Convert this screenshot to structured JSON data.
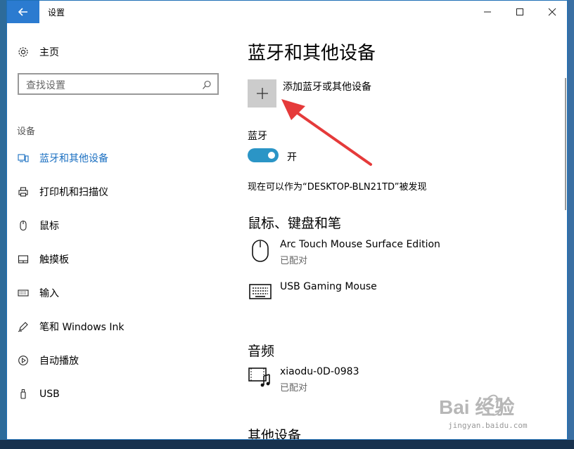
{
  "window": {
    "title": "设置"
  },
  "sidebar": {
    "home": "主页",
    "search_placeholder": "查找设置",
    "section": "设备",
    "items": [
      {
        "label": "蓝牙和其他设备",
        "icon": "bluetooth-devices-icon",
        "active": true
      },
      {
        "label": "打印机和扫描仪",
        "icon": "printer-icon"
      },
      {
        "label": "鼠标",
        "icon": "mouse-icon"
      },
      {
        "label": "触摸板",
        "icon": "touchpad-icon"
      },
      {
        "label": "输入",
        "icon": "keyboard-icon"
      },
      {
        "label": "笔和 Windows Ink",
        "icon": "pen-icon"
      },
      {
        "label": "自动播放",
        "icon": "autoplay-icon"
      },
      {
        "label": "USB",
        "icon": "usb-icon"
      }
    ]
  },
  "main": {
    "title": "蓝牙和其他设备",
    "add_label": "添加蓝牙或其他设备",
    "bluetooth_heading": "蓝牙",
    "bluetooth_state": "开",
    "discoverable": "现在可以作为“DESKTOP-BLN21TD”被发现",
    "mouse_section": "鼠标、键盘和笔",
    "mouse_devices": [
      {
        "name": "Arc Touch Mouse Surface Edition",
        "status": "已配对",
        "icon": "mouse-icon"
      },
      {
        "name": "USB Gaming Mouse",
        "status": "",
        "icon": "keyboard-icon"
      }
    ],
    "audio_section": "音频",
    "audio_devices": [
      {
        "name": "xiaodu-0D-0983",
        "status": "已配对",
        "icon": "audio-device-icon"
      }
    ],
    "other_section": "其他设备"
  },
  "watermark": {
    "brand": "Bai 经验",
    "url": "jingyan.baidu.com"
  },
  "colors": {
    "accent": "#1a6fc1",
    "back_button": "#2b7bd0",
    "toggle_on": "#2b95c6",
    "arrow": "#e53a3a"
  }
}
